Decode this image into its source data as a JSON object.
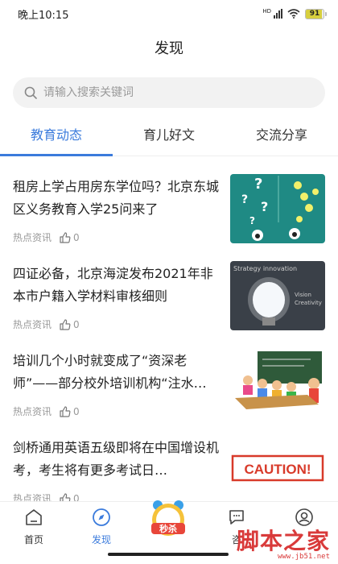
{
  "status_bar": {
    "time": "晚上10:15",
    "network": "HD",
    "battery": "91",
    "battery_level": 0.91
  },
  "page": {
    "title": "发现"
  },
  "search": {
    "placeholder": "请输入搜索关键词"
  },
  "tabs": [
    {
      "label": "教育动态",
      "active": true
    },
    {
      "label": "育儿好文",
      "active": false
    },
    {
      "label": "交流分享",
      "active": false
    }
  ],
  "articles": [
    {
      "title": "租房上学占用房东学位吗？北京东城区义务教育入学25问来了",
      "category": "热点资讯",
      "likes": "0"
    },
    {
      "title": "四证必备，北京海淀发布2021年非本市户籍入学材料审核细则",
      "category": "热点资讯",
      "likes": "0"
    },
    {
      "title": "培训几个小时就变成了“资深老师”——部分校外培训机构“注水…",
      "category": "热点资讯",
      "likes": "0"
    },
    {
      "title": "剑桥通用英语五级即将在中国增设机考，考生将有更多考试日…",
      "category": "热点资讯",
      "likes": "0"
    }
  ],
  "thumbnails": {
    "thumb2_text_top": "Strategy innovation",
    "thumb2_text_mid": "Vision",
    "thumb2_text_low": "Creativity",
    "thumb4_text": "CAUTION!"
  },
  "bottom_nav": {
    "items": [
      {
        "label": "首页",
        "icon": "home-icon",
        "active": false
      },
      {
        "label": "发现",
        "icon": "compass-icon",
        "active": true
      },
      {
        "label": "咨",
        "icon": "chat-icon",
        "active": false
      },
      {
        "label": "",
        "icon": "profile-icon",
        "active": false
      }
    ],
    "badge_text": "秒杀"
  },
  "watermark": {
    "main": "脚本之家",
    "url": "www.jb51.net"
  },
  "colors": {
    "accent": "#3b7bdc",
    "watermark": "#d93a3a"
  }
}
